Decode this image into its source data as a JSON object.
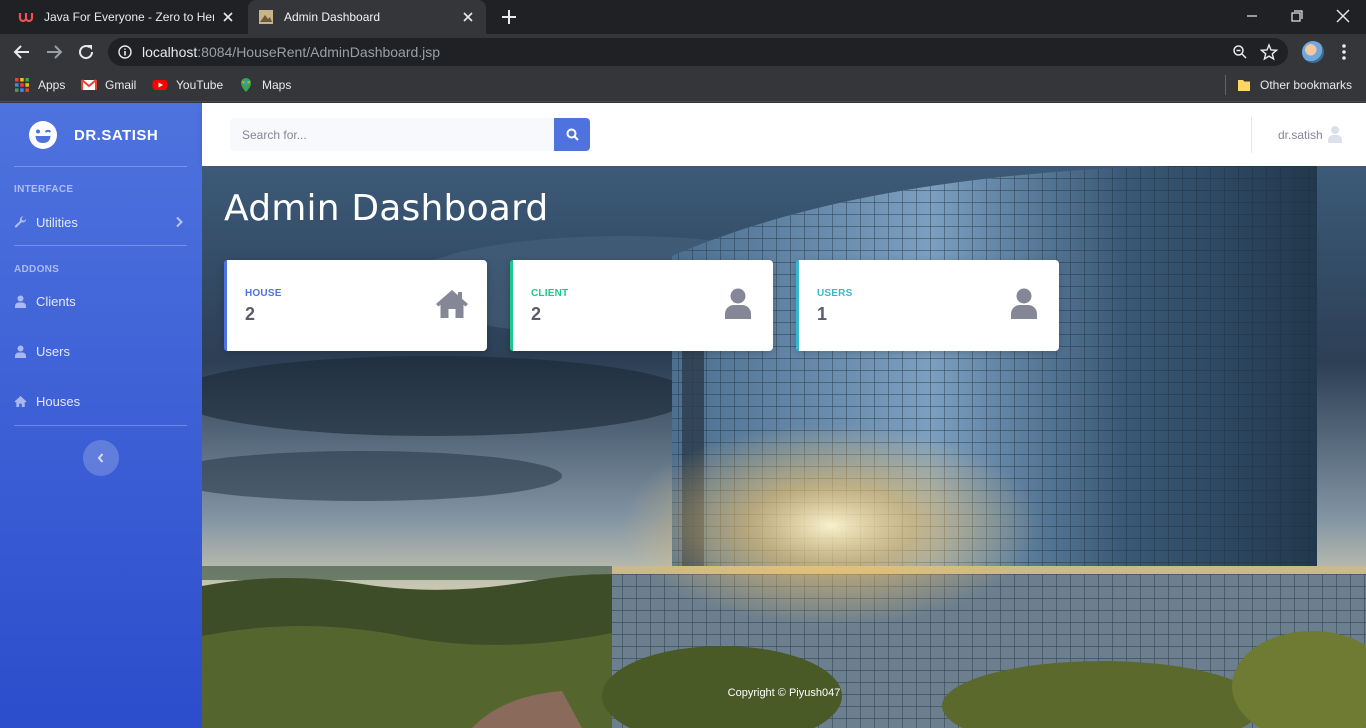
{
  "browser": {
    "tabs": [
      {
        "title": "Java For Everyone - Zero to Hero",
        "active": false
      },
      {
        "title": "Admin Dashboard",
        "active": true
      }
    ],
    "url_host": "localhost",
    "url_rest": ":8084/HouseRent/AdminDashboard.jsp",
    "bookmarks": [
      "Apps",
      "Gmail",
      "YouTube",
      "Maps"
    ],
    "other_bookmarks": "Other bookmarks"
  },
  "sidebar": {
    "brand": "DR.SATISH",
    "heading_interface": "INTERFACE",
    "heading_addons": "ADDONS",
    "items": [
      {
        "label": "Utilities",
        "icon": "wrench-icon"
      },
      {
        "label": "Clients",
        "icon": "user-icon"
      },
      {
        "label": "Users",
        "icon": "user-icon"
      },
      {
        "label": "Houses",
        "icon": "home-icon"
      }
    ]
  },
  "topbar": {
    "search_placeholder": "Search for...",
    "user_name": "dr.satish"
  },
  "main": {
    "title": "Admin Dashboard",
    "cards": [
      {
        "label": "HOUSE",
        "value": "2",
        "accent": "#4e73df",
        "icon": "home-icon"
      },
      {
        "label": "CLIENT",
        "value": "2",
        "accent": "#1cc88a",
        "icon": "user-icon"
      },
      {
        "label": "USERS",
        "value": "1",
        "accent": "#36b9cc",
        "icon": "user-icon"
      }
    ],
    "copyright": "Copyright © Piyush047"
  },
  "colors": {
    "primary": "#4e73df",
    "success": "#1cc88a",
    "info": "#36b9cc",
    "text_muted": "#5a5c69"
  }
}
